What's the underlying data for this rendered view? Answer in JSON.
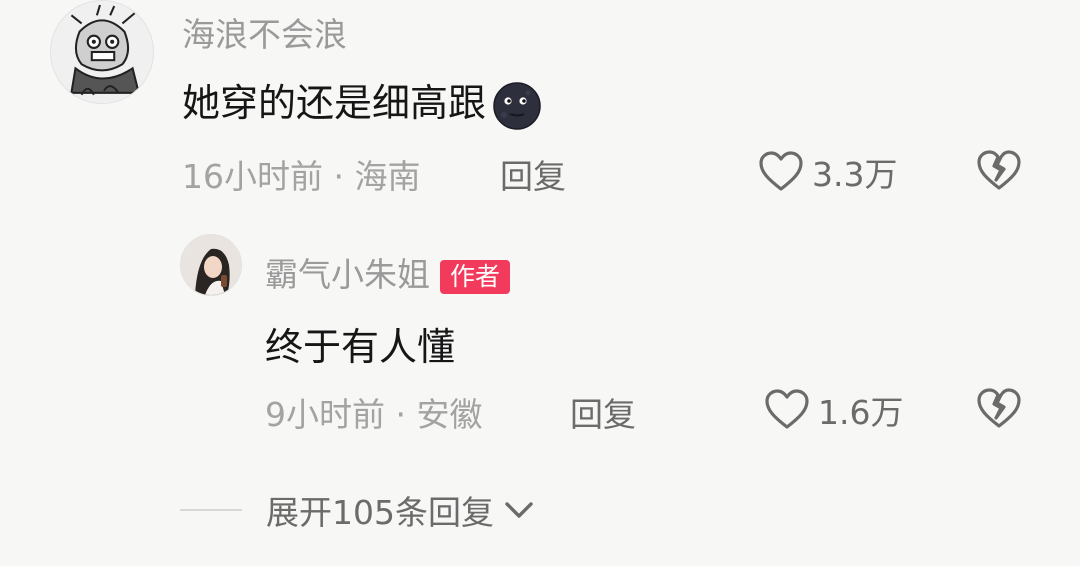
{
  "comments": [
    {
      "username": "海浪不会浪",
      "text": "她穿的还是细高跟",
      "emoji_icon": "new-moon-face-icon",
      "time": "16小时前",
      "separator": "·",
      "location": "海南",
      "reply_label": "回复",
      "likes": "3.3万"
    }
  ],
  "reply": {
    "username": "霸气小朱姐",
    "badge": "作者",
    "text": "终于有人懂",
    "time": "9小时前",
    "separator": "·",
    "location": "安徽",
    "reply_label": "回复",
    "likes": "1.6万"
  },
  "expand": {
    "label": "展开105条回复"
  },
  "colors": {
    "badge_bg": "#f23a5c",
    "meta_gray": "#a3a3a3",
    "action_gray": "#6b6b6b"
  }
}
